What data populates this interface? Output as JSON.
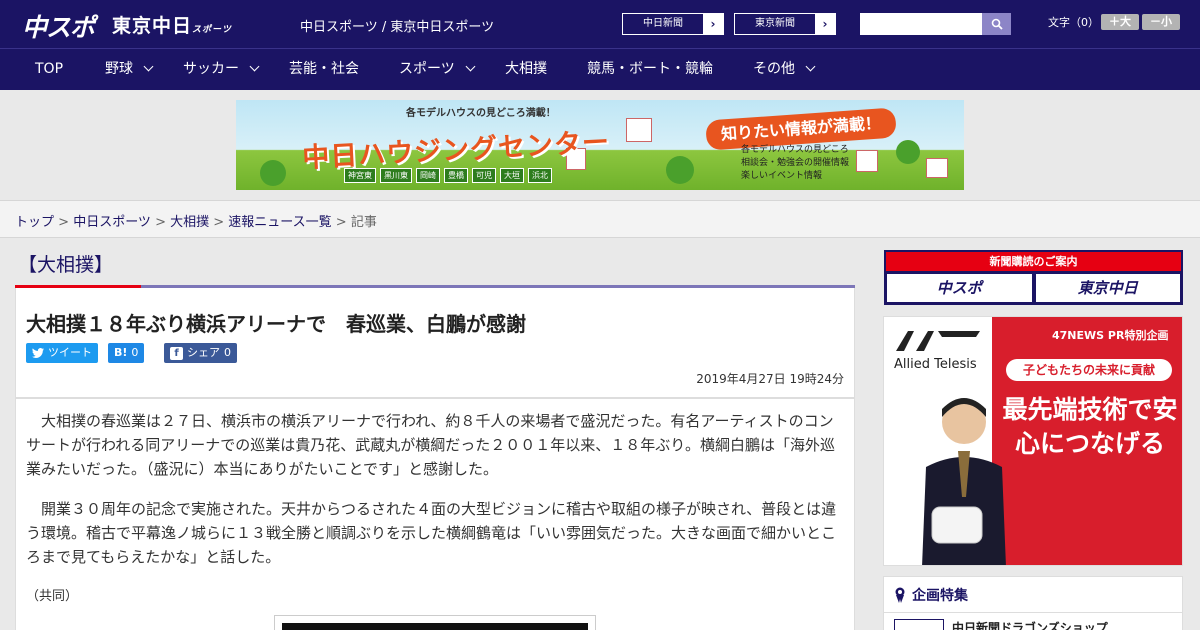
{
  "header": {
    "logo_main": "中スポ",
    "logo_sub": "東京中日",
    "logo_sub_small": "スポーツ",
    "site_name": "中日スポーツ / 東京中日スポーツ",
    "site_buttons": [
      "中日新聞",
      "東京新聞"
    ],
    "search_placeholder": "",
    "font_label": "文字（0）",
    "font_bigger": "＋大",
    "font_smaller": "－小"
  },
  "nav": {
    "items": [
      {
        "label": "TOP",
        "has_menu": false
      },
      {
        "label": "野球",
        "has_menu": true
      },
      {
        "label": "サッカー",
        "has_menu": true
      },
      {
        "label": "芸能・社会",
        "has_menu": false
      },
      {
        "label": "スポーツ",
        "has_menu": true
      },
      {
        "label": "大相撲",
        "has_menu": false
      },
      {
        "label": "競馬・ボート・競輪",
        "has_menu": false
      },
      {
        "label": "その他",
        "has_menu": true
      }
    ]
  },
  "banner": {
    "top_text": "各モデルハウスの見どころ満載！",
    "main_text": "中日ハウジングセンター",
    "callout": "知りたい情報が満載！",
    "list": [
      "各モデルハウスの見どころ",
      "相談会・勉強会の開催情報",
      "楽しいイベント情報"
    ],
    "cities": [
      "神宮東",
      "黒川東",
      "岡崎",
      "豊橋",
      "可児",
      "大垣",
      "浜北"
    ]
  },
  "breadcrumb": {
    "items": [
      "トップ",
      "中日スポーツ",
      "大相撲",
      "速報ニュース一覧"
    ],
    "current": "記事",
    "separator": " > "
  },
  "article": {
    "category": "【大相撲】",
    "title": "大相撲１８年ぶり横浜アリーナで　春巡業、白鵬が感謝",
    "share": {
      "tweet": "ツイート",
      "hatena_icon": "B!",
      "hatena_count": "0",
      "fb_icon": "f",
      "fb_label": "シェア",
      "fb_count": "0"
    },
    "date": "2019年4月27日 19時24分",
    "paragraphs": [
      "大相撲の春巡業は２７日、横浜市の横浜アリーナで行われ、約８千人の来場者で盛況だった。有名アーティストのコンサートが行われる同アリーナでの巡業は貴乃花、武蔵丸が横綱だった２００１年以来、１８年ぶり。横綱白鵬は「海外巡業みたいだった。（盛況に）本当にありがたいことです」と感謝した。",
      "開業３０周年の記念で実施された。天井からつるされた４面の大型ビジョンに稽古や取組の様子が映され、普段とは違う環境。稽古で平幕逸ノ城らに１３戦全勝と順調ぶりを示した横綱鶴竜は「いい雰囲気だった。大きな画面で細かいところまで見てもらえたかな」と話した。"
    ],
    "credit": "（共同）"
  },
  "sidebar": {
    "subscribe_head": "新聞購読のご案内",
    "subscribe_buttons": [
      "中スポ",
      "東京中日"
    ],
    "ad": {
      "brand": "Allied Telesis",
      "pr": "47NEWS PR特別企画",
      "pill": "子どもたちの未来に貢献",
      "big": "最先端技術で安心につなげる"
    },
    "feature_title": "企画特集",
    "feature_item": "中日新聞ドラゴンズショップ"
  },
  "colors": {
    "brand_navy": "#1b1464",
    "accent_red": "#e60012"
  }
}
